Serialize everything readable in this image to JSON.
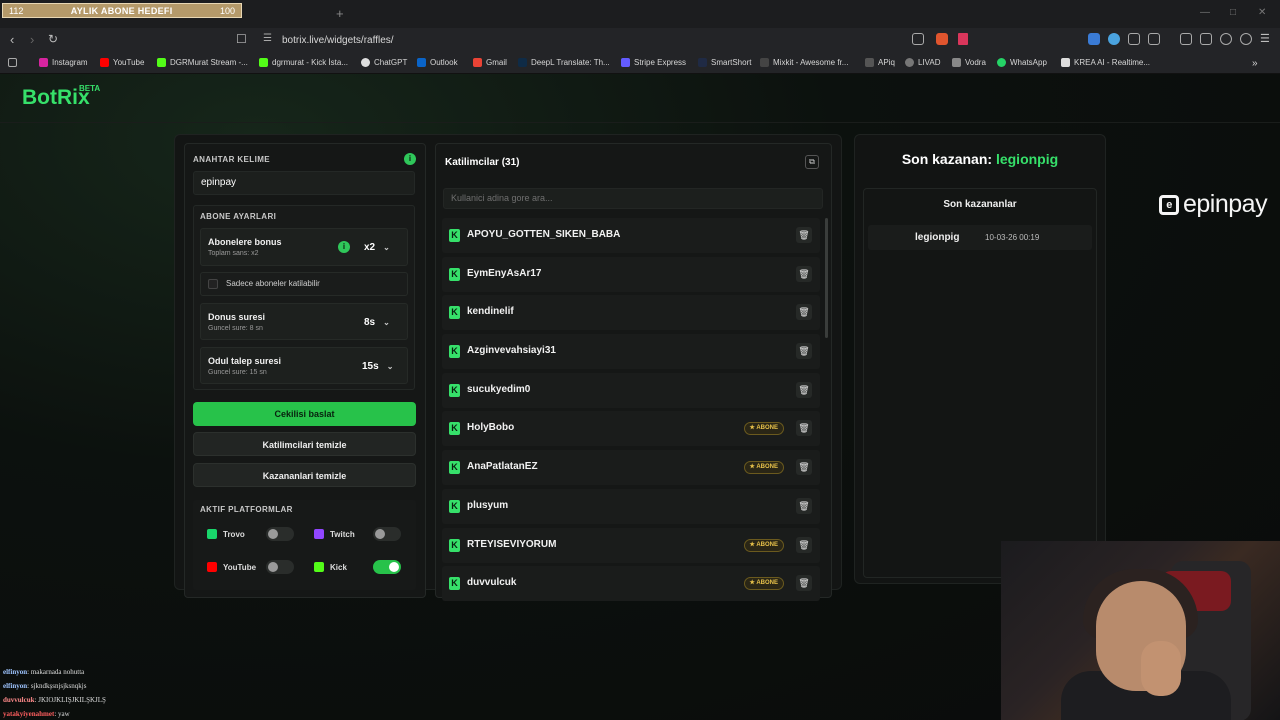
{
  "browser": {
    "sub_goal": {
      "left": "112",
      "label": "AYLIK ABONE HEDEFI",
      "right": "100"
    },
    "url": "botrix.live/widgets/raffles/",
    "bookmarks": [
      "Instagram",
      "YouTube",
      "DGRMurat Stream -...",
      "dgrmurat - Kick İsta...",
      "ChatGPT",
      "Outlook",
      "Gmail",
      "DeepL Translate: Th...",
      "Stripe Express",
      "SmartShort",
      "Mixkit - Awesome fr...",
      "APiq",
      "LIVAD",
      "Vodra",
      "WhatsApp",
      "KREA AI - Realtime..."
    ]
  },
  "app": {
    "logo": "BotRix",
    "beta": "BETA"
  },
  "settings": {
    "keyword_title": "ANAHTAR KELIME",
    "keyword_value": "epinpay",
    "sub_settings_title": "ABONE AYARLARI",
    "sub_bonus_title": "Abonelere bonus",
    "sub_bonus_sub": "Toplam sans: x2",
    "sub_bonus_value": "x2",
    "only_subs_label": "Sadece aboneler katilabilir",
    "spin_title": "Donus suresi",
    "spin_sub": "Guncel sure: 8 sn",
    "spin_value": "8s",
    "claim_title": "Odul talep suresi",
    "claim_sub": "Guncel sure: 15 sn",
    "claim_value": "15s",
    "start_button": "Cekilisi baslat",
    "clear_participants": "Katilimcilari temizle",
    "clear_winners": "Kazananlari temizle",
    "platforms_title": "AKTIF PLATFORMLAR",
    "platforms": [
      {
        "name": "Trovo",
        "enabled": false
      },
      {
        "name": "Twitch",
        "enabled": false
      },
      {
        "name": "YouTube",
        "enabled": false
      },
      {
        "name": "Kick",
        "enabled": true
      }
    ]
  },
  "participants": {
    "title": "Katilimcilar (31)",
    "search_placeholder": "Kullanici adina gore ara...",
    "badge_label": "ABONE",
    "list": [
      {
        "name": "APOYU_GOTTEN_SIKEN_BABA",
        "sub": false
      },
      {
        "name": "EymEnyAsAr17",
        "sub": false
      },
      {
        "name": "kendinelif",
        "sub": false
      },
      {
        "name": "Azginvevahsiayi31",
        "sub": false
      },
      {
        "name": "sucukyedim0",
        "sub": false
      },
      {
        "name": "HolyBobo",
        "sub": true
      },
      {
        "name": "AnaPatlatanEZ",
        "sub": true
      },
      {
        "name": "plusyum",
        "sub": false
      },
      {
        "name": "RTEYISEVIYORUM",
        "sub": true
      },
      {
        "name": "duvvulcuk",
        "sub": true
      }
    ]
  },
  "winner": {
    "last_winner_label": "Son kazanan:",
    "last_winner_name": "legionpig",
    "recent_title": "Son kazananlar",
    "recent": [
      {
        "name": "legionpig",
        "date": "10-03-26 00:19"
      }
    ]
  },
  "overlay": {
    "sponsor": "epinpay",
    "chat": [
      {
        "user": "elfinyon",
        "text": "makarnada nohutta"
      },
      {
        "user": "elfinyon",
        "text": "sjkndkşsnjsjksnqkjs"
      },
      {
        "user": "duvvulcuk",
        "text": "JKIOJKLIŞJKILŞKJLŞ"
      },
      {
        "user": "yatakyiyenahmet",
        "text": "yaw"
      }
    ]
  }
}
